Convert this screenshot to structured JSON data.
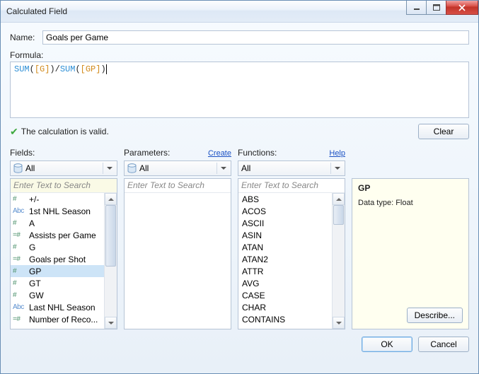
{
  "window": {
    "title": "Calculated Field"
  },
  "labels": {
    "name": "Name:",
    "formula": "Formula:",
    "valid": "The calculation is valid.",
    "clear": "Clear",
    "fields": "Fields:",
    "parameters": "Parameters:",
    "create": "Create",
    "functions": "Functions:",
    "help": "Help",
    "all": "All",
    "search_placeholder": "Enter Text to Search",
    "describe": "Describe...",
    "ok": "OK",
    "cancel": "Cancel"
  },
  "name_value": "Goals per Game",
  "formula": {
    "fn1": "SUM",
    "p1o": "(",
    "f1": "[G]",
    "p1c": ")",
    "op": "/",
    "fn2": "SUM",
    "p2o": "(",
    "f2": "[GP]",
    "p2c": ")"
  },
  "fields_list": [
    {
      "icon": "num",
      "label": "+/-"
    },
    {
      "icon": "abc",
      "label": "1st NHL Season"
    },
    {
      "icon": "num",
      "label": "A"
    },
    {
      "icon": "calc",
      "label": "Assists per Game"
    },
    {
      "icon": "num",
      "label": "G"
    },
    {
      "icon": "calc",
      "label": "Goals per Shot"
    },
    {
      "icon": "num",
      "label": "GP",
      "selected": true
    },
    {
      "icon": "num",
      "label": "GT"
    },
    {
      "icon": "num",
      "label": "GW"
    },
    {
      "icon": "abc",
      "label": "Last NHL Season"
    },
    {
      "icon": "calc",
      "label": "Number of Reco..."
    }
  ],
  "functions_list": [
    "ABS",
    "ACOS",
    "ASCII",
    "ASIN",
    "ATAN",
    "ATAN2",
    "ATTR",
    "AVG",
    "CASE",
    "CHAR",
    "CONTAINS"
  ],
  "help_panel": {
    "title": "GP",
    "datatype": "Data type: Float"
  }
}
